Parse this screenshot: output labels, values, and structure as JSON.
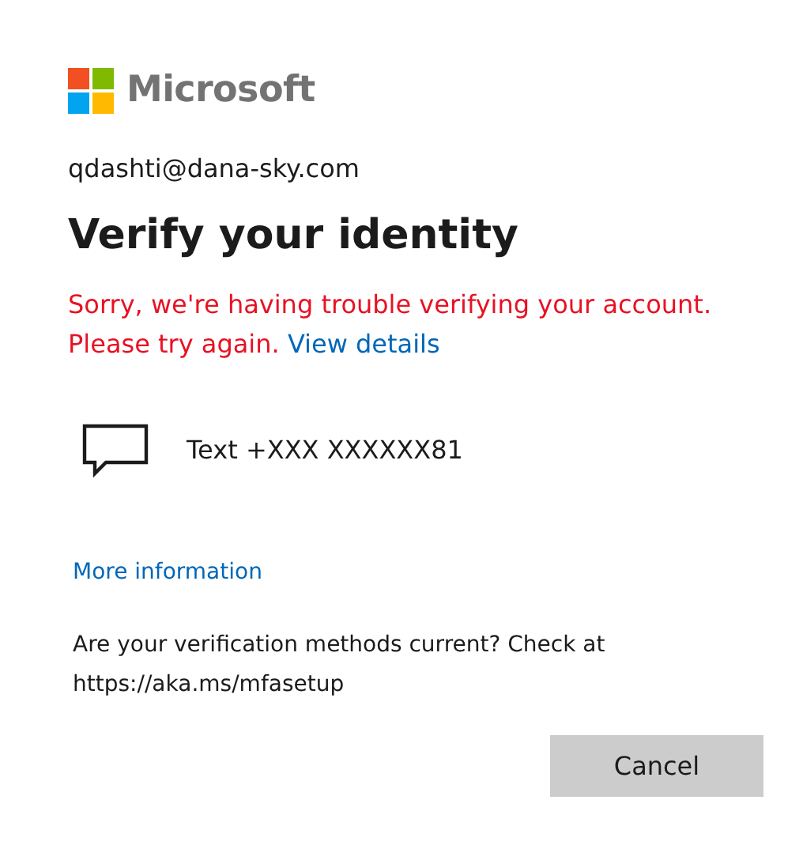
{
  "logo": {
    "text": "Microsoft"
  },
  "account": "qdashti@dana-sky.com",
  "title": "Verify your identity",
  "error": {
    "message": "Sorry, we're having trouble verifying your account. Please try again.",
    "link": "View details"
  },
  "methods": [
    {
      "kind": "text",
      "label": "Text +XXX XXXXXX81"
    }
  ],
  "more_info_link": "More information",
  "note": "Are your verification methods current? Check at https://aka.ms/mfasetup",
  "buttons": [
    {
      "label": "Cancel"
    }
  ]
}
